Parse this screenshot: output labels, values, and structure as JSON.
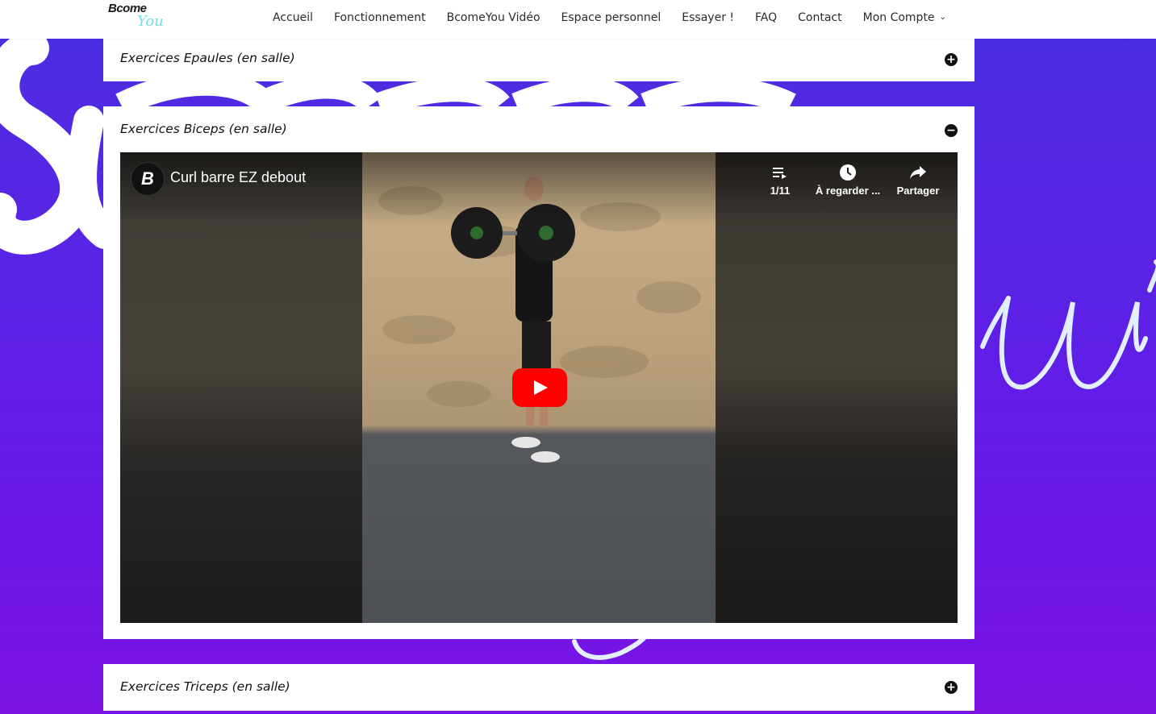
{
  "header": {
    "logo_primary": "Bcome",
    "logo_secondary": "You",
    "nav": [
      "Accueil",
      "Fonctionnement",
      "BcomeYou Vidéo",
      "Espace personnel",
      "Essayer !",
      "FAQ",
      "Contact"
    ],
    "account_label": "Mon Compte"
  },
  "accordion": [
    {
      "title": "Exercices Epaules (en salle)",
      "state": "collapsed",
      "toggle": "+"
    },
    {
      "title": "Exercices Biceps (en salle)",
      "state": "expanded",
      "toggle": "−"
    },
    {
      "title": "Exercices Triceps (en salle)",
      "state": "collapsed",
      "toggle": "+"
    }
  ],
  "video": {
    "channel_initial": "B",
    "title": "Curl barre EZ debout",
    "playlist_position": "1/11",
    "watch_later_label": "À regarder ...",
    "share_label": "Partager",
    "play_button_color": "#ff0000"
  },
  "colors": {
    "background_gradient": [
      "#4a2fe0",
      "#7a13e2"
    ],
    "header_bg": "#ffffff",
    "panel_bg": "#ffffff",
    "neon_accent": "#dff7ff"
  }
}
